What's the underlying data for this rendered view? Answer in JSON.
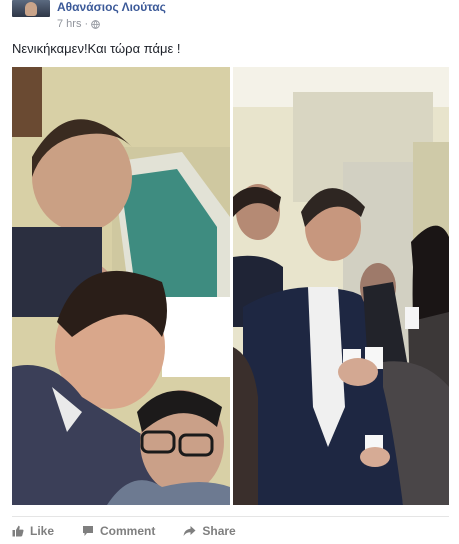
{
  "post": {
    "author": "Αθανάσιος Λιούτας",
    "time": "7 hrs",
    "separator": "·",
    "text": "Νενικήκαμεν!Και τώρα πάμε !"
  },
  "actions": {
    "like": "Like",
    "comment": "Comment",
    "share": "Share"
  },
  "icons": {
    "privacy": "globe-icon",
    "like": "thumbs-up-icon",
    "comment": "speech-bubble-icon",
    "share": "share-arrow-icon"
  },
  "colors": {
    "author_link": "#3b5998",
    "meta_text": "#90949c",
    "action_text": "#7f7f7f"
  }
}
